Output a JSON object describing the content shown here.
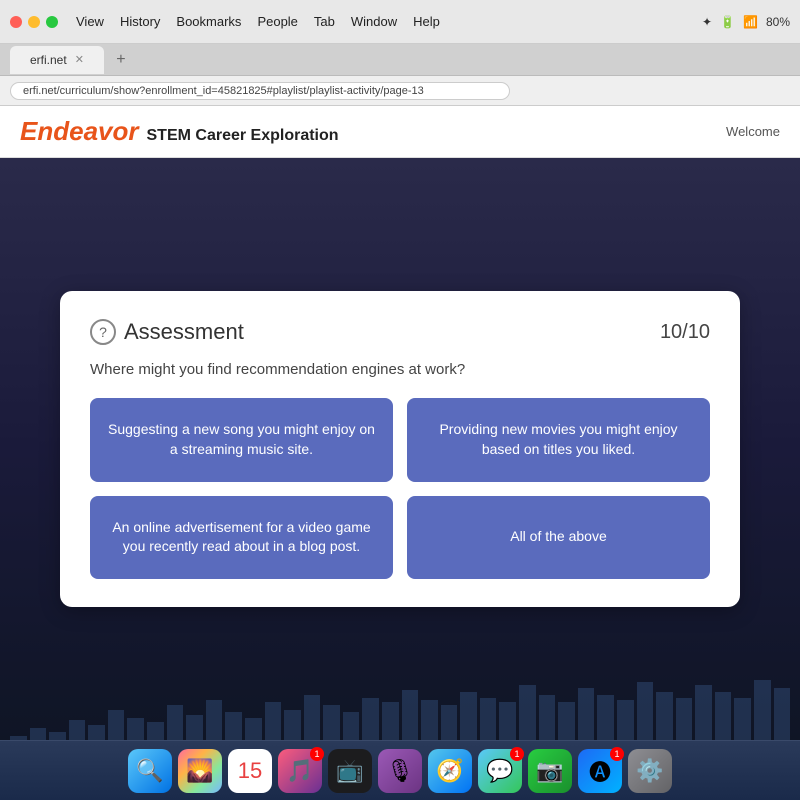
{
  "browser": {
    "menu_items": [
      "View",
      "History",
      "Bookmarks",
      "People",
      "Tab",
      "Window",
      "Help"
    ],
    "tab_label": "erfi.net",
    "address": "erfi.net/curriculum/show?enrollment_id=45821825#playlist/playlist-activity/page-13",
    "battery": "80%"
  },
  "site": {
    "logo_name": "Endeavor",
    "logo_subtitle": "STEM Career Exploration",
    "welcome_label": "Welcome"
  },
  "assessment": {
    "title": "Assessment",
    "progress": "10/10",
    "question": "Where might you find recommendation engines at work?",
    "answers": [
      {
        "id": "a1",
        "text": "Suggesting a new song you might enjoy on a streaming music site."
      },
      {
        "id": "a2",
        "text": "Providing new movies you might enjoy based on titles you liked."
      },
      {
        "id": "a3",
        "text": "An online advertisement for a video game you recently read about in a blog post."
      },
      {
        "id": "a4",
        "text": "All of the above"
      }
    ]
  },
  "dock": {
    "items": [
      {
        "id": "finder",
        "emoji": "🔍",
        "class": "dock-finder"
      },
      {
        "id": "photos",
        "emoji": "🌄",
        "class": "dock-photos",
        "badge": ""
      },
      {
        "id": "calendar",
        "emoji": "15",
        "class": "dock-calendar"
      },
      {
        "id": "music",
        "emoji": "🎵",
        "class": "dock-music",
        "badge": "1"
      },
      {
        "id": "appletv",
        "emoji": "📺",
        "class": "dock-appletv"
      },
      {
        "id": "podcasts",
        "emoji": "🎙",
        "class": "dock-podcasts"
      },
      {
        "id": "safari",
        "emoji": "🧭",
        "class": "dock-safari"
      },
      {
        "id": "messages",
        "emoji": "💬",
        "class": "dock-messages",
        "badge": "1"
      },
      {
        "id": "facetime",
        "emoji": "📷",
        "class": "dock-facetime"
      },
      {
        "id": "appstore",
        "emoji": "🅐",
        "class": "dock-appstore",
        "badge": "1"
      },
      {
        "id": "system",
        "emoji": "⚙️",
        "class": "dock-system"
      }
    ]
  },
  "eq_bars": [
    4,
    12,
    8,
    20,
    15,
    30,
    22,
    18,
    35,
    25,
    40,
    28,
    22,
    38,
    30,
    45,
    35,
    28,
    42,
    38,
    50,
    40,
    35,
    48,
    42,
    38,
    55,
    45,
    38,
    52,
    45,
    40,
    58,
    48,
    42,
    55,
    48,
    42,
    60,
    52
  ]
}
